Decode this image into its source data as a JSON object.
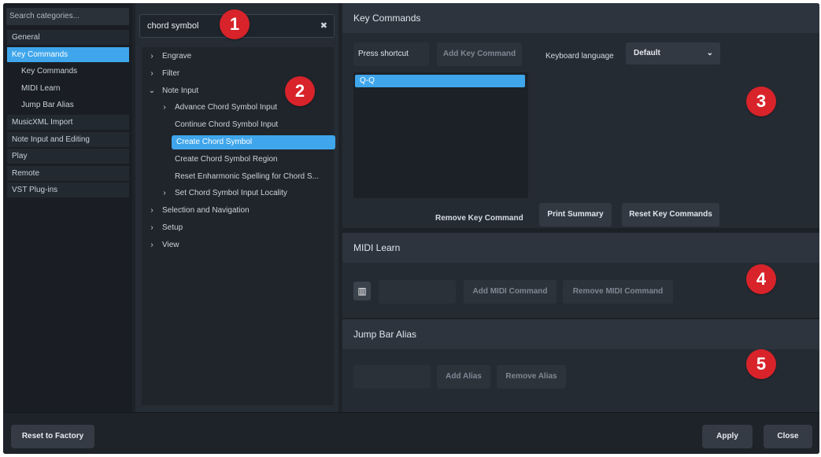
{
  "categories": {
    "search_placeholder": "Search categories...",
    "items": [
      {
        "label": "General",
        "level": 0
      },
      {
        "label": "Key Commands",
        "level": 0,
        "selected": true
      },
      {
        "label": "Key Commands",
        "level": 1
      },
      {
        "label": "MIDI Learn",
        "level": 1
      },
      {
        "label": "Jump Bar Alias",
        "level": 1
      },
      {
        "label": "MusicXML Import",
        "level": 0
      },
      {
        "label": "Note Input and Editing",
        "level": 0
      },
      {
        "label": "Play",
        "level": 0
      },
      {
        "label": "Remote",
        "level": 0
      },
      {
        "label": "VST Plug-ins",
        "level": 0
      }
    ]
  },
  "tree": {
    "search_value": "chord symbol",
    "clear_icon": "close-icon",
    "items": [
      {
        "label": "Engrave",
        "level": 0,
        "chevron": "›"
      },
      {
        "label": "Filter",
        "level": 0,
        "chevron": "›"
      },
      {
        "label": "Note Input",
        "level": 0,
        "chevron": "⌄"
      },
      {
        "label": "Advance Chord Symbol Input",
        "level": 1,
        "chevron": "›"
      },
      {
        "label": "Continue Chord Symbol Input",
        "level": 2,
        "chevron": ""
      },
      {
        "label": "Create Chord Symbol",
        "level": 2,
        "chevron": "",
        "selected": true
      },
      {
        "label": "Create Chord Symbol Region",
        "level": 2,
        "chevron": ""
      },
      {
        "label": "Reset Enharmonic Spelling for Chord S...",
        "level": 2,
        "chevron": ""
      },
      {
        "label": "Set Chord Symbol Input Locality",
        "level": 1,
        "chevron": "›"
      },
      {
        "label": "Selection and Navigation",
        "level": 0,
        "chevron": "›"
      },
      {
        "label": "Setup",
        "level": 0,
        "chevron": "›"
      },
      {
        "label": "View",
        "level": 0,
        "chevron": "›"
      }
    ]
  },
  "key_commands": {
    "header": "Key Commands",
    "press_shortcut": "Press shortcut",
    "add_key_command": "Add Key Command",
    "keyboard_language_label": "Keyboard language",
    "keyboard_language_value": "Default",
    "assigned": [
      "Q-Q"
    ],
    "remove_key_command": "Remove Key Command",
    "print_summary": "Print Summary",
    "reset_key_commands": "Reset Key Commands"
  },
  "midi_learn": {
    "header": "MIDI Learn",
    "add_midi_command": "Add MIDI Command",
    "remove_midi_command": "Remove MIDI Command"
  },
  "jump_bar_alias": {
    "header": "Jump Bar Alias",
    "add_alias": "Add Alias",
    "remove_alias": "Remove Alias"
  },
  "footer": {
    "reset_to_factory": "Reset to Factory",
    "apply": "Apply",
    "close": "Close"
  },
  "callouts": [
    "1",
    "2",
    "3",
    "4",
    "5"
  ],
  "colors": {
    "accent": "#3fa6ec",
    "callout": "#d8232a"
  }
}
